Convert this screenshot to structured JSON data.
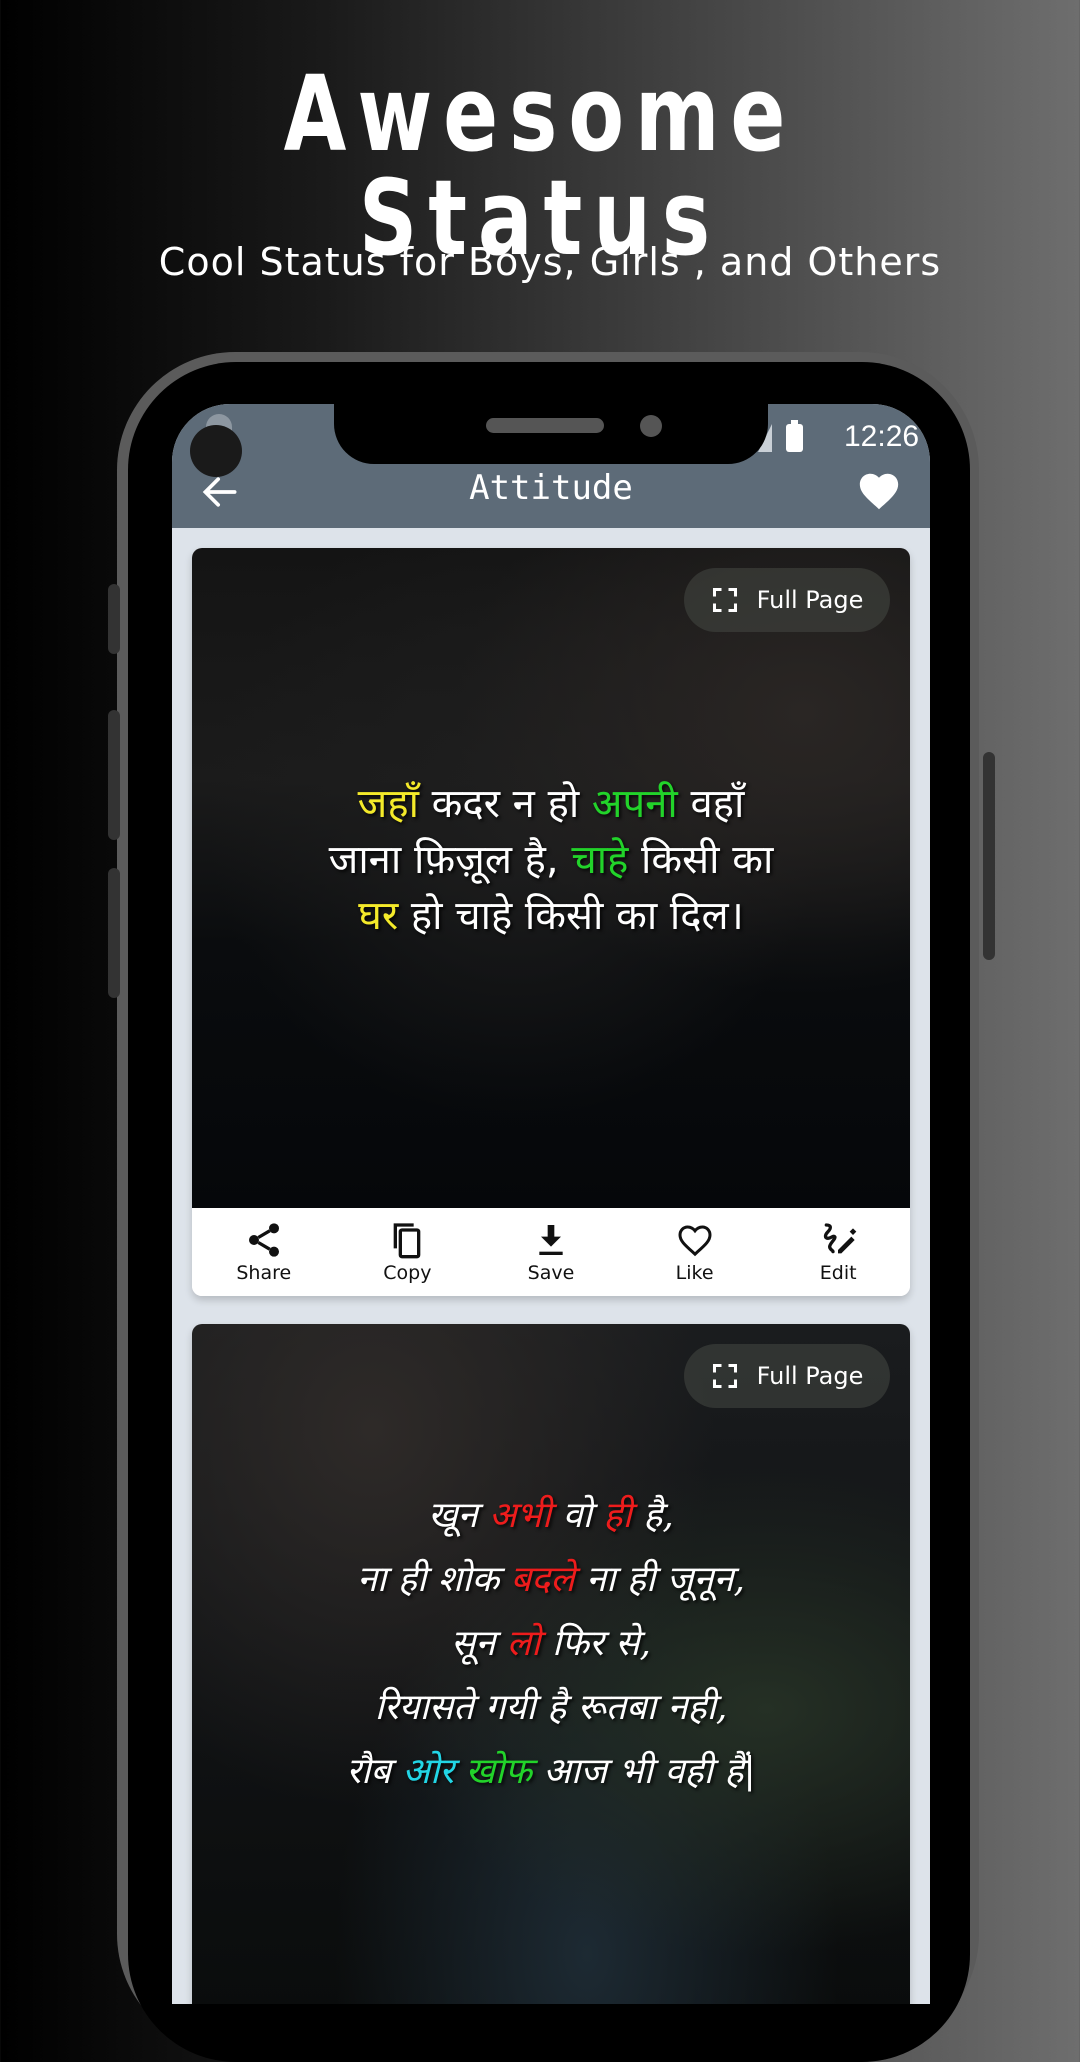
{
  "promo": {
    "title": "Awesome Status",
    "subtitle": "Cool Status for Boys, Girls , and Others"
  },
  "status_bar": {
    "time": "12:26",
    "icons": [
      "signal-icon",
      "battery-icon"
    ]
  },
  "app_bar": {
    "title": "Attitude",
    "back_icon": "arrow-left-icon",
    "favorite_icon": "heart-filled-icon"
  },
  "cards": [
    {
      "full_page_label": "Full Page",
      "quote_lines": [
        [
          {
            "t": "जहाँ",
            "c": "yellow"
          },
          {
            "t": " कदर न हो ",
            "c": "white"
          },
          {
            "t": "अपनी",
            "c": "green"
          },
          {
            "t": " वहाँ",
            "c": "white"
          }
        ],
        [
          {
            "t": "जाना फ़िज़ूल है,  ",
            "c": "white"
          },
          {
            "t": "चाहे",
            "c": "green"
          },
          {
            "t": " किसी का",
            "c": "white"
          }
        ],
        [
          {
            "t": "घर",
            "c": "yellow"
          },
          {
            "t": " हो चाहे किसी का दिल।",
            "c": "white"
          }
        ]
      ],
      "actions": [
        {
          "label": "Share",
          "icon": "share-icon"
        },
        {
          "label": "Copy",
          "icon": "copy-icon"
        },
        {
          "label": "Save",
          "icon": "download-icon"
        },
        {
          "label": "Like",
          "icon": "heart-outline-icon"
        },
        {
          "label": "Edit",
          "icon": "edit-pen-icon"
        }
      ]
    },
    {
      "full_page_label": "Full Page",
      "quote_lines": [
        [
          {
            "t": "खून ",
            "c": "white"
          },
          {
            "t": "अभी",
            "c": "red"
          },
          {
            "t": " वो ",
            "c": "white"
          },
          {
            "t": "ही",
            "c": "red"
          },
          {
            "t": " है,",
            "c": "white"
          }
        ],
        [
          {
            "t": "ना ही शोक ",
            "c": "white"
          },
          {
            "t": "बदले",
            "c": "red"
          },
          {
            "t": " ना ही जूनून,",
            "c": "white"
          }
        ],
        [
          {
            "t": "सून ",
            "c": "white"
          },
          {
            "t": "लो",
            "c": "red"
          },
          {
            "t": " फिर से,",
            "c": "white"
          }
        ],
        [
          {
            "t": "रियासते गयी है रूतबा नही,",
            "c": "white"
          }
        ],
        [
          {
            "t": "रौब ",
            "c": "white"
          },
          {
            "t": "ओर",
            "c": "cyan"
          },
          {
            "t": " ",
            "c": "white"
          },
          {
            "t": "खोफ",
            "c": "green"
          },
          {
            "t": " आज भी वही हैं|",
            "c": "white"
          }
        ]
      ]
    }
  ]
}
